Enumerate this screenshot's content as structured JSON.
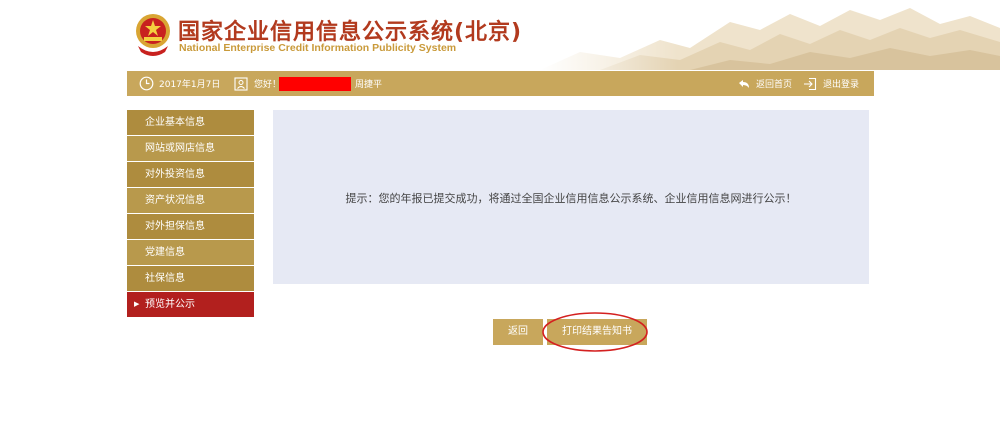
{
  "header": {
    "title_cn": "国家企业信用信息公示系统(北京)",
    "title_en": "National Enterprise Credit Information Publicity System"
  },
  "topbar": {
    "date": "2017年1月7日",
    "greeting": "您好！",
    "user_name": "周捷平",
    "home_label": "返回首页",
    "logout_label": "退出登录"
  },
  "sidebar": {
    "items": [
      {
        "label": "企业基本信息"
      },
      {
        "label": "网站或网店信息"
      },
      {
        "label": "对外投资信息"
      },
      {
        "label": "资产状况信息"
      },
      {
        "label": "对外担保信息"
      },
      {
        "label": "党建信息"
      },
      {
        "label": "社保信息"
      },
      {
        "label": "预览并公示",
        "active": true
      }
    ]
  },
  "main": {
    "notice": "提示：您的年报已提交成功，将通过全国企业信用信息公示系统、企业信用信息网进行公示！"
  },
  "buttons": {
    "back_label": "返回",
    "print_label": "打印结果告知书"
  },
  "colors": {
    "gold": "#c8a75c",
    "sidebar": "#ae8c3e",
    "active": "#b2201e",
    "notice_bg": "#e6e9f4",
    "title_red": "#b23a1e"
  }
}
